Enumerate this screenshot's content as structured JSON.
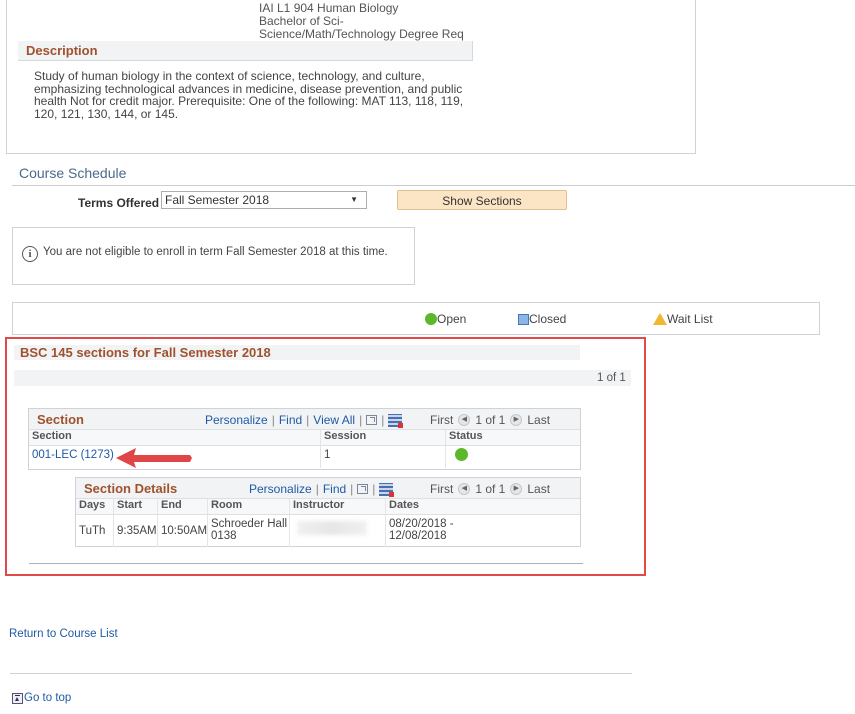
{
  "course_attributes": {
    "lines": [
      "IAI L1 904 Human Biology",
      "Bachelor of Sci-",
      "Science/Math/Technology Degree Req"
    ]
  },
  "description": {
    "header": "Description",
    "text": "Study of human biology in the context of science, technology, and culture, emphasizing technological advances in medicine, disease prevention, and public health Not for credit major. Prerequisite: One of the following: MAT 113, 118, 119, 120, 121, 130, 144, or 145."
  },
  "course_schedule": {
    "title": "Course Schedule",
    "terms_label": "Terms Offered",
    "terms_selected": "Fall Semester 2018",
    "show_sections_label": "Show Sections",
    "info_message": "You are not eligible to enroll in term Fall Semester 2018 at this time."
  },
  "legend": {
    "open": "Open",
    "closed": "Closed",
    "wait_list": "Wait List"
  },
  "sections": {
    "title": "BSC 145 sections for Fall Semester 2018",
    "pager": "1 of 1",
    "grid": {
      "title": "Section",
      "personalize": "Personalize",
      "find": "Find",
      "view_all": "View All",
      "first": "First",
      "count": "1 of 1",
      "last": "Last",
      "columns": [
        "Section",
        "Session",
        "Status"
      ],
      "rows": [
        {
          "section": "001-LEC (1273)",
          "session": "1",
          "status": "Open"
        }
      ]
    },
    "details": {
      "title": "Section Details",
      "personalize": "Personalize",
      "find": "Find",
      "first": "First",
      "count": "1 of 1",
      "last": "Last",
      "columns": [
        "Days",
        "Start",
        "End",
        "Room",
        "Instructor",
        "Dates"
      ],
      "rows": [
        {
          "days": "TuTh",
          "start": "9:35AM",
          "end": "10:50AM",
          "room_line1": "Schroeder Hall",
          "room_line2": "0138",
          "instructor": "",
          "dates_line1": "08/20/2018 -",
          "dates_line2": "12/08/2018"
        }
      ]
    }
  },
  "footer": {
    "return_link": "Return to Course List",
    "go_to_top": "Go to top"
  },
  "colors": {
    "accent_header": "#a0522d",
    "link": "#1f5aa6",
    "open_status": "#5cb82b",
    "highlight_box": "#e24a4a",
    "button_bg": "#fce5c4"
  }
}
